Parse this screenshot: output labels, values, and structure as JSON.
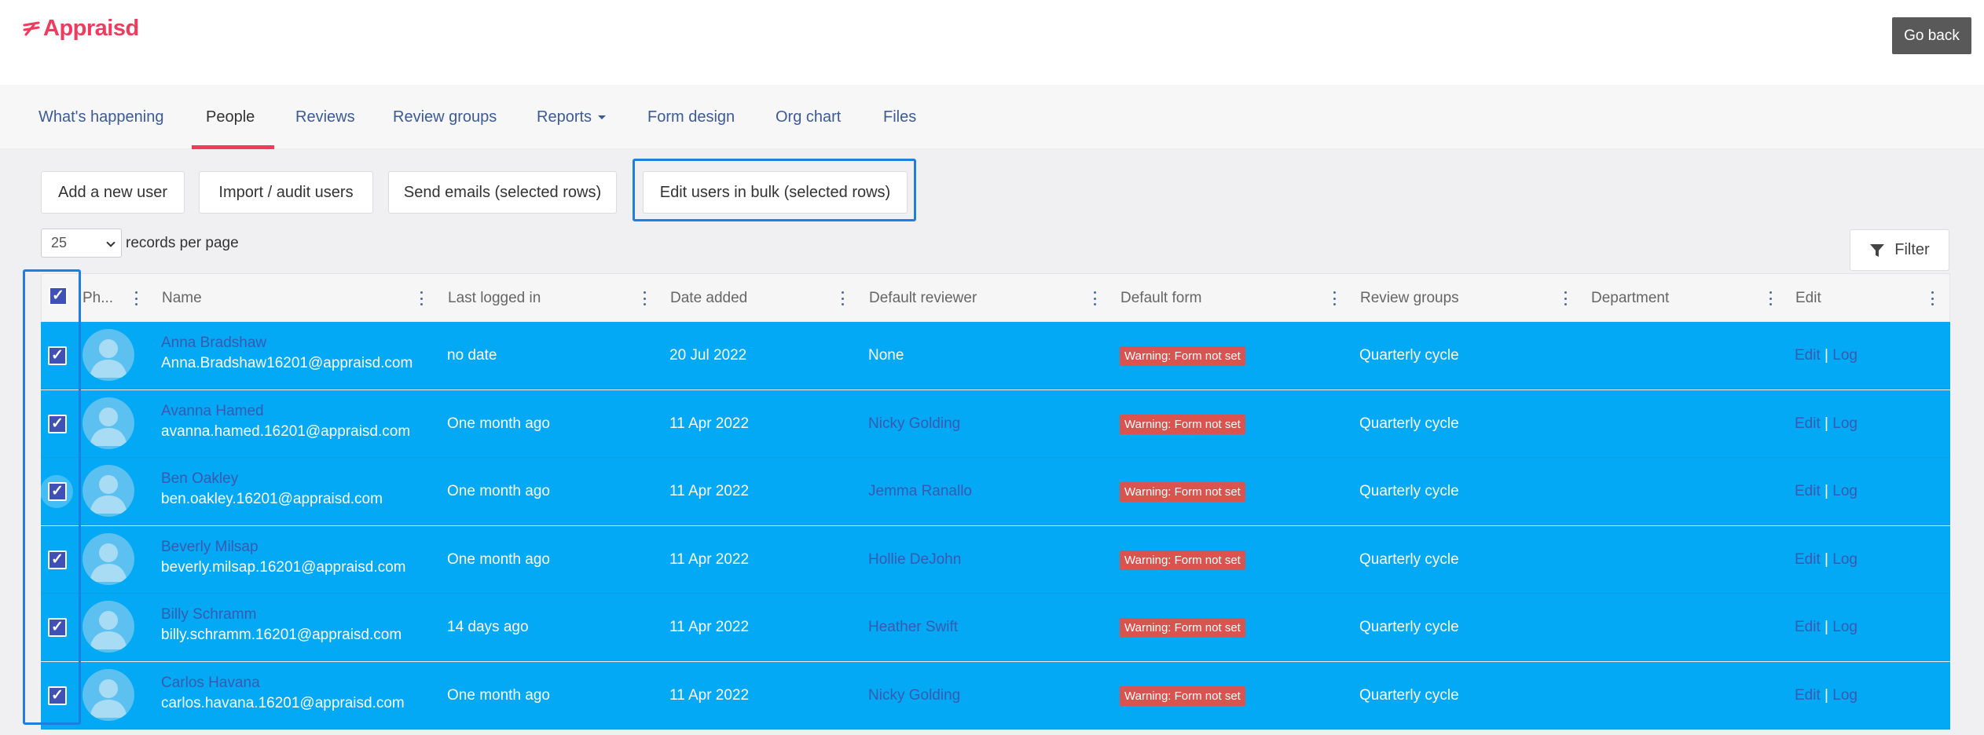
{
  "app": {
    "logo_text": "Appraisd",
    "go_back": "Go back",
    "brand_color": "#ee3b5e",
    "accent_color": "#03a9f4"
  },
  "nav": {
    "items": [
      {
        "label": "What's happening"
      },
      {
        "label": "People",
        "active": true
      },
      {
        "label": "Reviews"
      },
      {
        "label": "Review groups"
      },
      {
        "label": "Reports"
      },
      {
        "label": "Form design"
      },
      {
        "label": "Org chart"
      },
      {
        "label": "Files"
      }
    ]
  },
  "toolbar": {
    "add_user": "Add a new user",
    "import_audit": "Import / audit users",
    "send_emails": "Send emails (selected rows)",
    "edit_bulk": "Edit users in bulk (selected rows)"
  },
  "paging": {
    "per_page_value": "25",
    "per_page_label": "records per page"
  },
  "filter": {
    "label": "Filter",
    "icon": "filter-icon"
  },
  "table": {
    "columns": [
      "Ph...",
      "Name",
      "Last logged in",
      "Date added",
      "Default reviewer",
      "Default form",
      "Review groups",
      "Department",
      "Edit"
    ],
    "header_checked": true,
    "rows": [
      {
        "name": "Anna Bradshaw",
        "email": "Anna.Bradshaw16201@appraisd.com",
        "last_logged_in": "no date",
        "date_added": "20 Jul 2022",
        "default_reviewer": "None",
        "reviewer_is_link": false,
        "default_form": "Warning: Form not set",
        "review_groups": "Quarterly cycle",
        "department": "",
        "edit": "Edit",
        "sep": "|",
        "log": "Log",
        "checked": true
      },
      {
        "name": "Avanna Hamed",
        "email": "avanna.hamed.16201@appraisd.com",
        "last_logged_in": "One month ago",
        "date_added": "11 Apr 2022",
        "default_reviewer": "Nicky Golding",
        "reviewer_is_link": true,
        "default_form": "Warning: Form not set",
        "review_groups": "Quarterly cycle",
        "department": "",
        "edit": "Edit",
        "sep": "|",
        "log": "Log",
        "checked": true
      },
      {
        "name": "Ben Oakley",
        "email": "ben.oakley.16201@appraisd.com",
        "last_logged_in": "One month ago",
        "date_added": "11 Apr 2022",
        "default_reviewer": "Jemma Ranallo",
        "reviewer_is_link": true,
        "default_form": "Warning: Form not set",
        "review_groups": "Quarterly cycle",
        "department": "",
        "edit": "Edit",
        "sep": "|",
        "log": "Log",
        "checked": true
      },
      {
        "name": "Beverly Milsap",
        "email": "beverly.milsap.16201@appraisd.com",
        "last_logged_in": "One month ago",
        "date_added": "11 Apr 2022",
        "default_reviewer": "Hollie DeJohn",
        "reviewer_is_link": true,
        "default_form": "Warning: Form not set",
        "review_groups": "Quarterly cycle",
        "department": "",
        "edit": "Edit",
        "sep": "|",
        "log": "Log",
        "checked": true
      },
      {
        "name": "Billy Schramm",
        "email": "billy.schramm.16201@appraisd.com",
        "last_logged_in": "14 days ago",
        "date_added": "11 Apr 2022",
        "default_reviewer": "Heather Swift",
        "reviewer_is_link": true,
        "default_form": "Warning: Form not set",
        "review_groups": "Quarterly cycle",
        "department": "",
        "edit": "Edit",
        "sep": "|",
        "log": "Log",
        "checked": true
      },
      {
        "name": "Carlos Havana",
        "email": "carlos.havana.16201@appraisd.com",
        "last_logged_in": "One month ago",
        "date_added": "11 Apr 2022",
        "default_reviewer": "Nicky Golding",
        "reviewer_is_link": true,
        "default_form": "Warning: Form not set",
        "review_groups": "Quarterly cycle",
        "department": "",
        "edit": "Edit",
        "sep": "|",
        "log": "Log",
        "checked": true
      }
    ]
  }
}
